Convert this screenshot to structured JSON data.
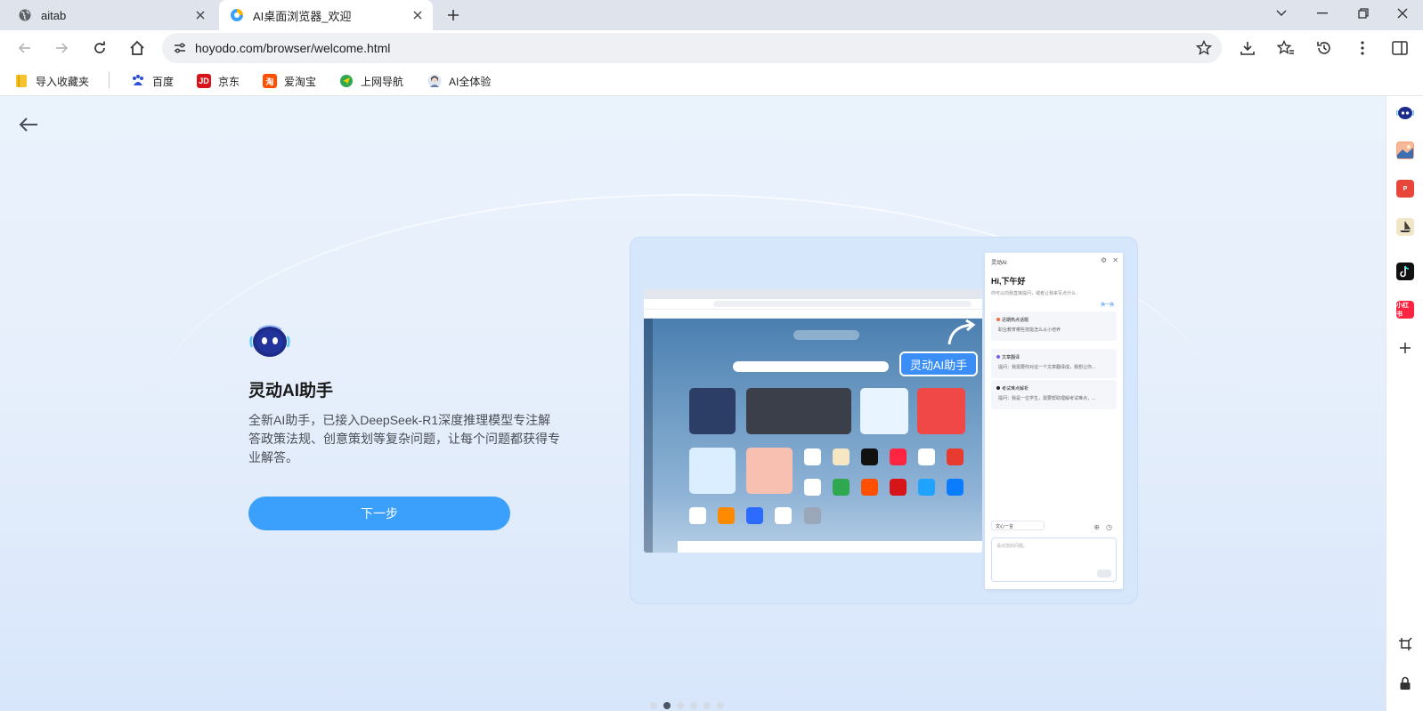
{
  "tabs": [
    {
      "title": "aitab",
      "icon": "globe-icon",
      "active": false
    },
    {
      "title": "AI桌面浏览器_欢迎",
      "icon": "browser-logo-icon",
      "active": true
    }
  ],
  "toolbar": {
    "url": "hoyodo.com/browser/welcome.html"
  },
  "bookmarks": [
    {
      "label": "导入收藏夹",
      "icon": "folder-icon",
      "color": "#f4c430"
    },
    {
      "label": "百度",
      "icon": "baidu-icon",
      "color": "#2b4fd8"
    },
    {
      "label": "京东",
      "icon": "jd-icon",
      "color": "#d7141a"
    },
    {
      "label": "爱淘宝",
      "icon": "taobao-icon",
      "color": "#ff5000"
    },
    {
      "label": "上网导航",
      "icon": "navigation-icon",
      "color": "#2fa84f"
    },
    {
      "label": "AI全体验",
      "icon": "ai-avatar-icon",
      "color": "#6b7fa8"
    }
  ],
  "feature": {
    "title": "灵动AI助手",
    "description": "全新AI助手，已接入DeepSeek-R1深度推理模型专注解答政策法规、创意策划等复杂问题，让每个问题都获得专业解答。",
    "next_label": "下一步"
  },
  "preview": {
    "badge": "灵动AI助手",
    "panel": {
      "header": "灵动AI",
      "greeting": "Hi,下午好",
      "subtitle": "你可以向我直接提问，或者让我来写点什么：",
      "switch_label": "换一换",
      "cards": [
        {
          "title": "近期热点话题",
          "desc": "职业教育哪些技能怎么从小培养",
          "color": "#ff6a3d"
        },
        {
          "title": "文章翻译",
          "desc": "提问：我需要你对这一个文章翻译成，我想让你...",
          "color": "#7a5af8"
        },
        {
          "title": "考试难点解析",
          "desc": "提问：我是一位学生，需要帮助理解考试难点，...",
          "color": "#222"
        }
      ],
      "model": "文心一言",
      "input_placeholder": "请点您的问题。"
    }
  },
  "pager": {
    "count": 6,
    "active_index": 1
  },
  "accent_color": "#3aa0fb"
}
